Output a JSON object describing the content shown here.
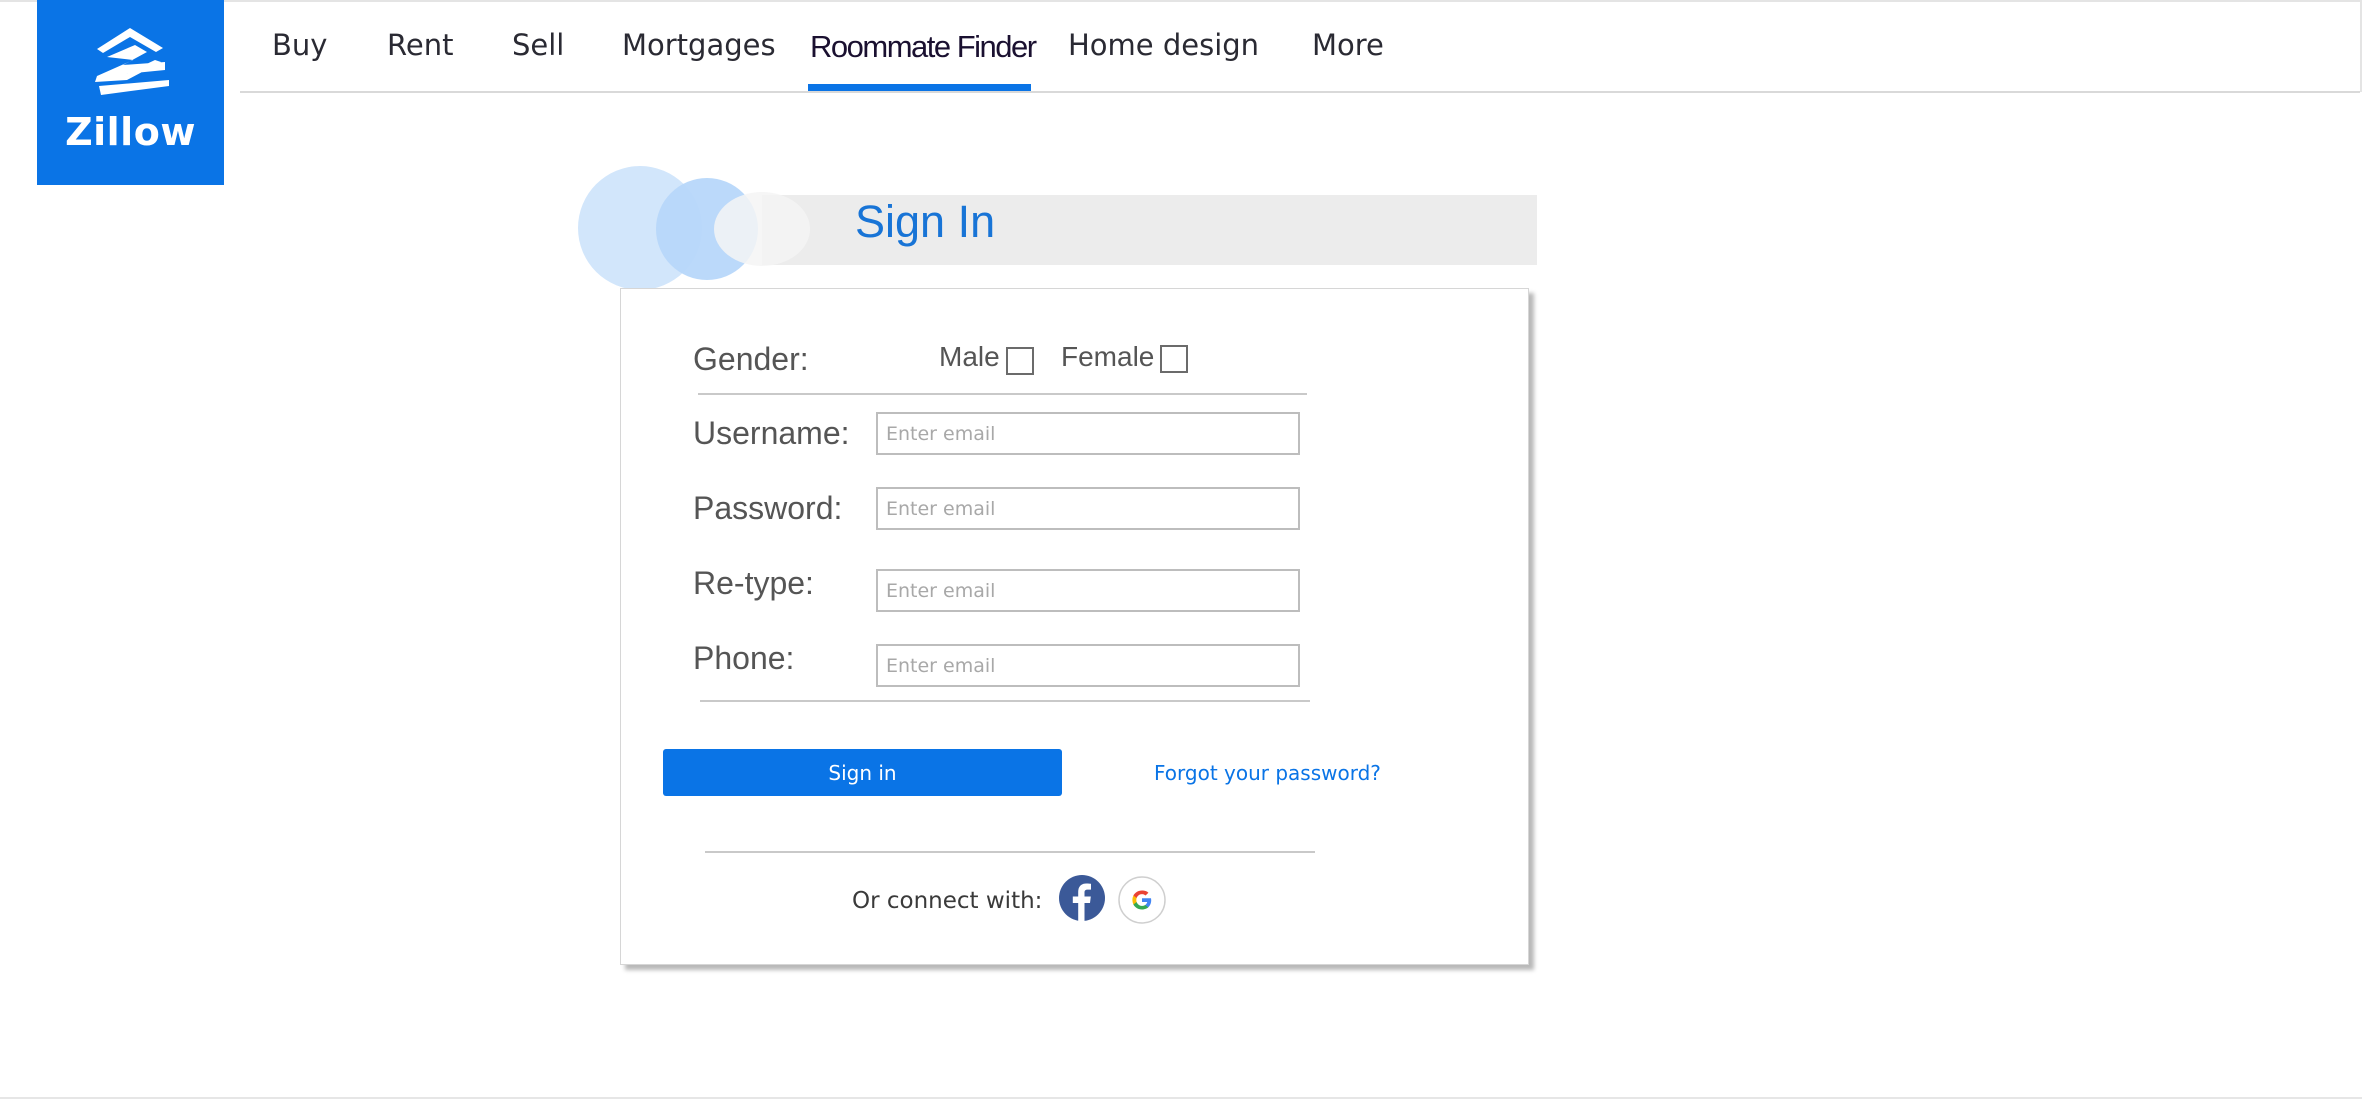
{
  "brand": {
    "logo_text": "Zillow",
    "color": "#0a74e6"
  },
  "nav": {
    "items": [
      {
        "label": "Buy"
      },
      {
        "label": "Rent"
      },
      {
        "label": "Sell"
      },
      {
        "label": "Mortgages"
      },
      {
        "label": "Roommate Finder",
        "active": true
      },
      {
        "label": "Home design"
      },
      {
        "label": "More"
      }
    ]
  },
  "form": {
    "title": "Sign In",
    "gender_label": "Gender:",
    "male_label": "Male",
    "female_label": "Female",
    "fields": [
      {
        "label": "Username:",
        "placeholder": "Enter email",
        "value": ""
      },
      {
        "label": "Password:",
        "placeholder": "Enter email",
        "value": ""
      },
      {
        "label": "Re-type:",
        "placeholder": "Enter email",
        "value": ""
      },
      {
        "label": "Phone:",
        "placeholder": "Enter email",
        "value": ""
      }
    ],
    "signin_label": "Sign in",
    "forgot_label": "Forgot your password?",
    "connect_label": "Or connect with:",
    "social": [
      {
        "icon": "facebook-icon",
        "color": "#3b5998"
      },
      {
        "icon": "google-icon"
      }
    ]
  }
}
